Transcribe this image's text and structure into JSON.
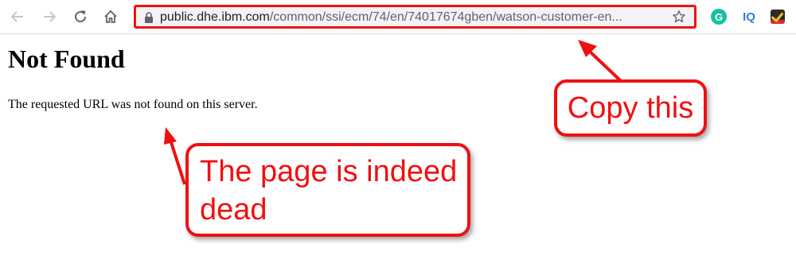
{
  "browser": {
    "url_host": "public.dhe.ibm.com",
    "url_path": "/common/ssi/ecm/74/en/74017674gben/watson-customer-en...",
    "icons": [
      "back-icon",
      "forward-icon",
      "reload-icon",
      "home-icon",
      "lock-icon",
      "bookmark-star-icon"
    ],
    "extensions": {
      "grammarly_glyph": "G",
      "iq_label": "IQ"
    }
  },
  "page": {
    "title": "Not Found",
    "message": "The requested URL was not found on this server."
  },
  "annotations": {
    "copy_label": "Copy this",
    "dead_label": "The page is indeed dead",
    "color": "#f01010"
  }
}
